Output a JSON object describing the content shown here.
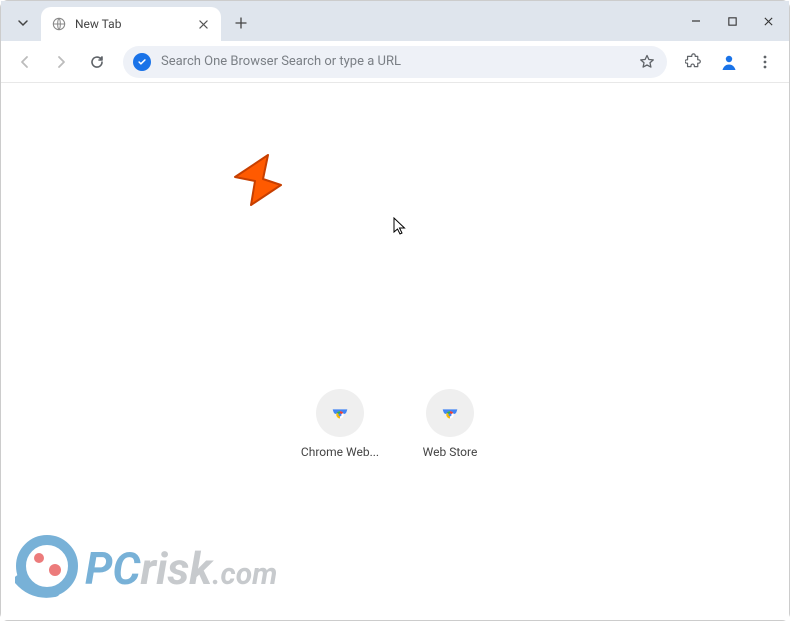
{
  "window": {
    "tab_title": "New Tab"
  },
  "omnibox": {
    "placeholder": "Search One Browser Search or type a URL",
    "value": ""
  },
  "shortcuts": [
    {
      "label": "Chrome Web..."
    },
    {
      "label": "Web Store"
    }
  ],
  "watermark": {
    "text": "PCrisk.com"
  }
}
